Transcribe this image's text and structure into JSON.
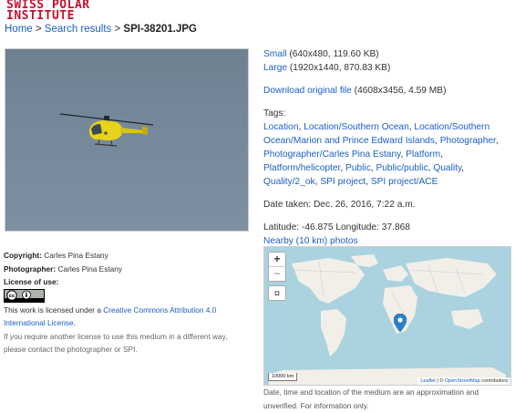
{
  "logo": {
    "line1": "SWISS POLAR",
    "line2": "INSTITUTE"
  },
  "breadcrumb": {
    "home": "Home",
    "sep1": " > ",
    "search": "Search results",
    "sep2": " > ",
    "current": "SPI-38201.JPG"
  },
  "left": {
    "copyright_label": "Copyright:",
    "copyright_value": "Carles Pina Estany",
    "photographer_label": "Photographer:",
    "photographer_value": "Carles Pina Estany",
    "license_label": "License of use:",
    "license_prefix": "This work is licensed under a ",
    "license_link": "Creative Commons Attribution 4.0 International License",
    "license_suffix": ".",
    "other_license": "If you require another license to use this medium in a different way, please contact the photographer or SPI."
  },
  "downloads": {
    "small_label": "Small",
    "small_info": " (640x480, 119.60 KB)",
    "large_label": "Large",
    "large_info": " (1920x1440, 870.83 KB)",
    "original_label": "Download original file",
    "original_info": " (4608x3456, 4.59 MB)"
  },
  "tags": {
    "title": "Tags:",
    "items": [
      "Location",
      "Location/Southern Ocean",
      "Location/Southern Ocean/Marion and Prince Edward Islands",
      "Photographer",
      "Photographer/Carles Pina Estany",
      "Platform",
      "Platform/helicopter",
      "Public",
      "Public/public",
      "Quality",
      "Quality/2_ok",
      "SPI project",
      "SPI project/ACE"
    ]
  },
  "date": {
    "label": "Date taken:",
    "value": "Dec. 26, 2016, 7:22 a.m."
  },
  "location": {
    "lat_label": "Latitude:",
    "lat": "-46.875",
    "lon_label": "Longitude:",
    "lon": "37.868",
    "nearby": "Nearby (10 km) photos"
  },
  "map": {
    "zoom_in": "+",
    "zoom_out": "−",
    "fullscreen": "◘",
    "scale": "10000 km",
    "attribution_leaflet": "Leaflet",
    "attribution_sep": " | © ",
    "attribution_osm": "OpenStreetMap",
    "attribution_suffix": " contributors"
  },
  "note": "Date, time and location of the medium are an approximation and unverified. For information only.",
  "colors": {
    "brand": "#c8102e",
    "link": "#1a5fc7",
    "water": "#aad3df",
    "land": "#f2efe9",
    "marker": "#2a81cb",
    "heli": "#e8d21a"
  }
}
